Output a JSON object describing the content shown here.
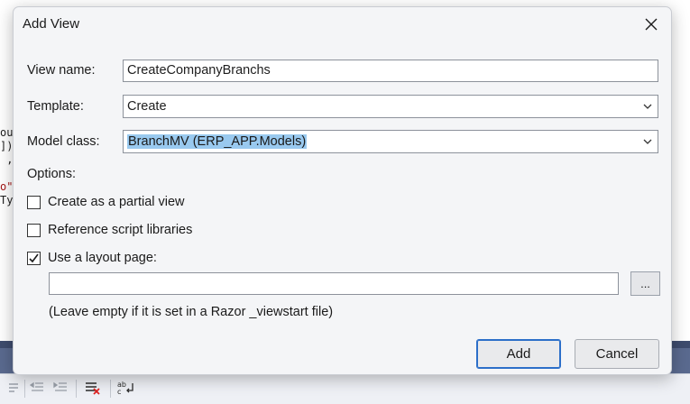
{
  "background": {
    "code_lines": [
      "out",
      "]),",
      " ,",
      "  c",
      "o\"]",
      "Typ"
    ]
  },
  "dialog": {
    "title": "Add View",
    "close_icon": "close-icon",
    "view_name": {
      "label": "View name:",
      "value": "CreateCompanyBranchs"
    },
    "template": {
      "label": "Template:",
      "value": "Create"
    },
    "model_class": {
      "label": "Model class:",
      "value": "BranchMV (ERP_APP.Models)"
    },
    "options_label": "Options:",
    "options": {
      "partial_view": {
        "label": "Create as a partial view",
        "checked": false
      },
      "script_libraries": {
        "label": "Reference script libraries",
        "checked": false
      },
      "layout_page": {
        "label": "Use a layout page:",
        "checked": true
      }
    },
    "layout_path": {
      "value": "",
      "browse_label": "..."
    },
    "hint": "(Leave empty if it is set in a Razor _viewstart file)",
    "add_label": "Add",
    "cancel_label": "Cancel"
  },
  "colors": {
    "dialog_bg": "#f4f5f7",
    "selection": "#99c9ef",
    "primary_border": "#2c6fc9"
  }
}
